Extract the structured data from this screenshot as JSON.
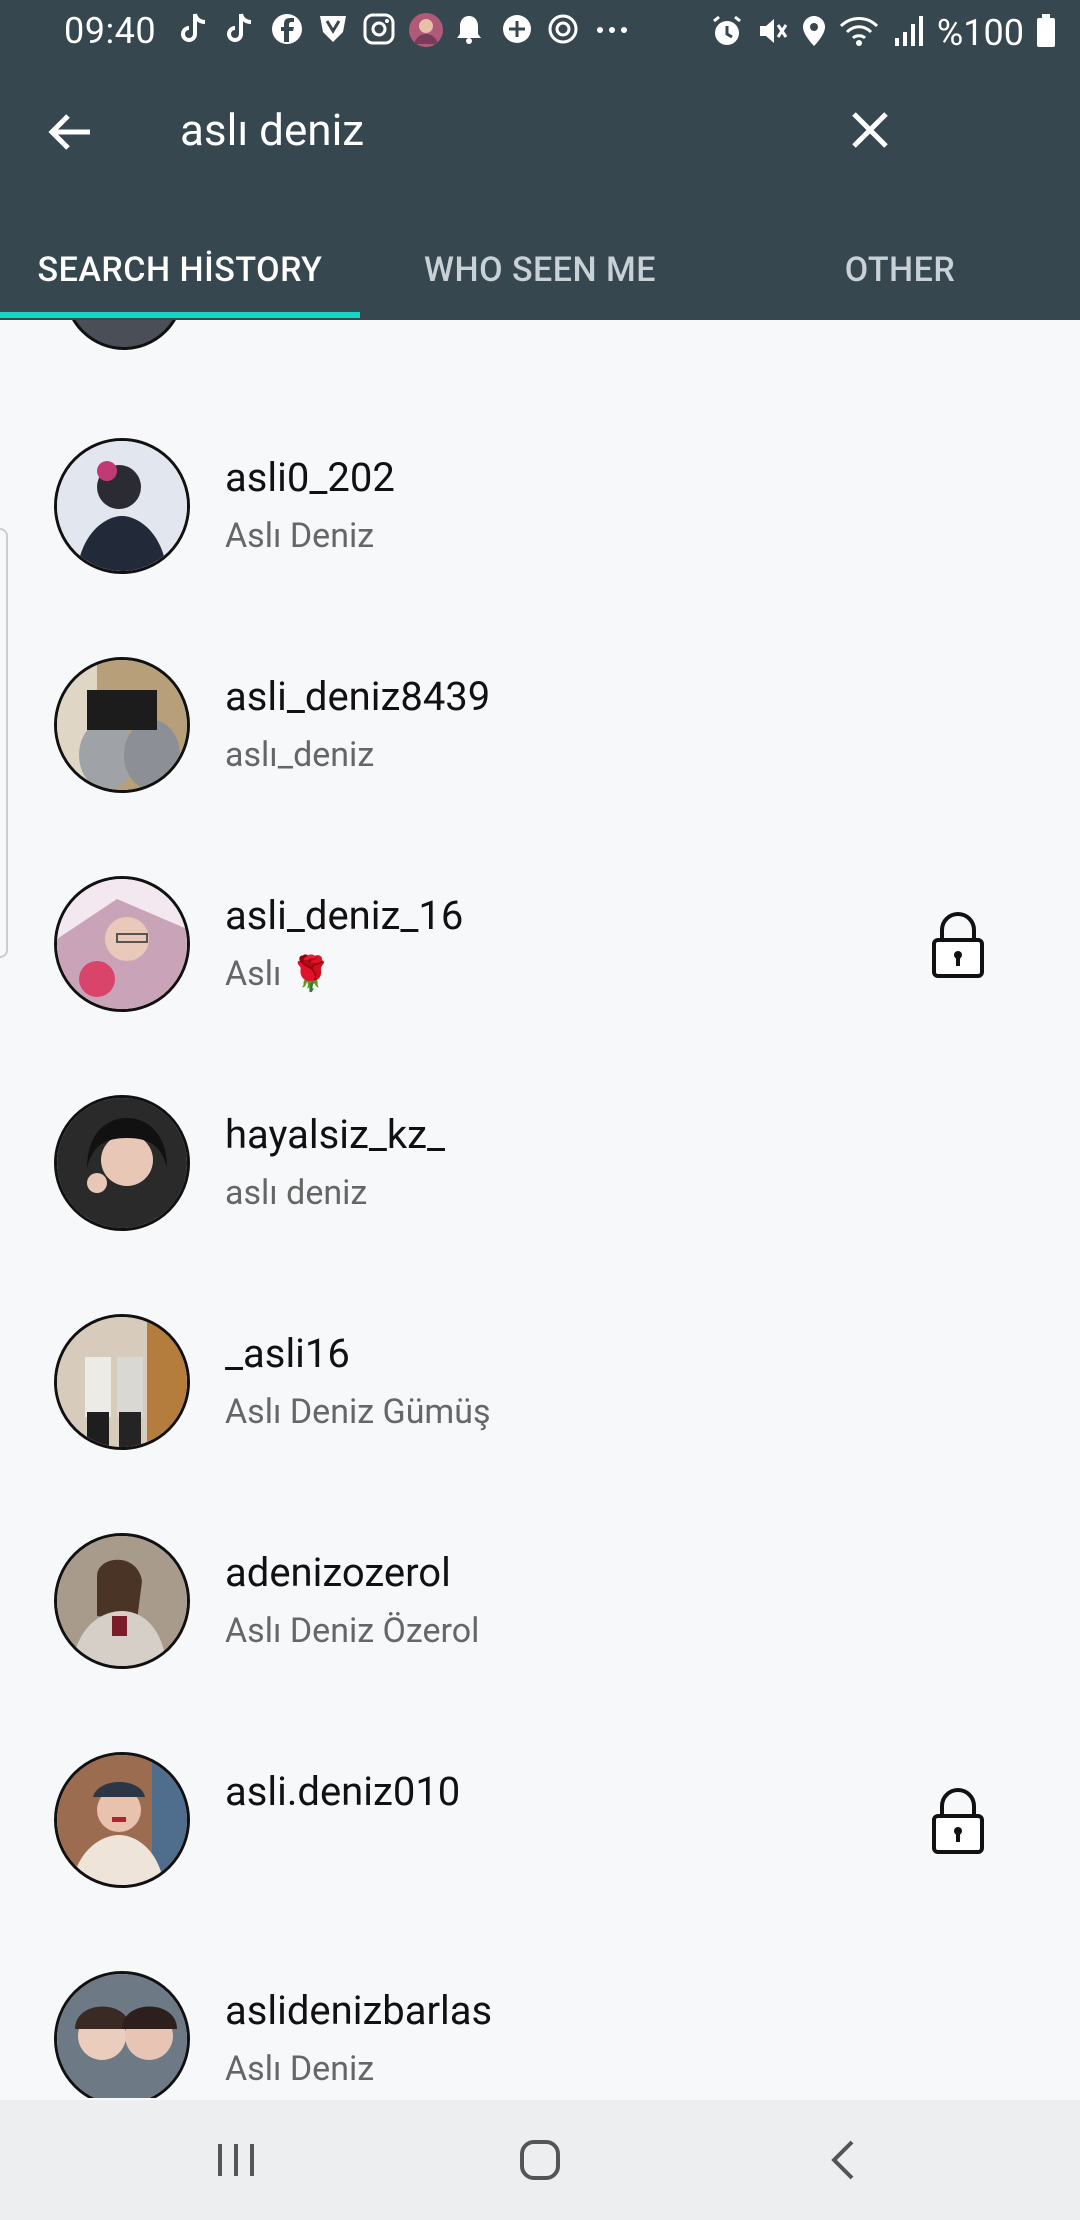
{
  "status_bar": {
    "time": "09:40",
    "battery": "%100",
    "icons": [
      "tiktok-icon",
      "tiktok-icon",
      "facebook-icon",
      "shield-icon",
      "instagram-icon",
      "avatar-icon",
      "bell-icon",
      "vpn-icon",
      "sync-icon",
      "more-icon",
      "alarm-icon",
      "mute-icon",
      "location-icon",
      "wifi-icon",
      "signal-icon",
      "battery-icon"
    ]
  },
  "appbar": {
    "search_query": "aslı deniz"
  },
  "tabs": [
    {
      "label": "SEARCH HİSTORY",
      "active": true
    },
    {
      "label": "WHO SEEN ME",
      "active": false
    },
    {
      "label": "OTHER",
      "active": false
    }
  ],
  "results": [
    {
      "username": "asli0_202",
      "fullname": "Aslı Deniz",
      "locked": false,
      "avatar_color": "#d6dbe4"
    },
    {
      "username": "asli_deniz8439",
      "fullname": "aslı_deniz",
      "locked": false,
      "avatar_color": "#8c7a66"
    },
    {
      "username": "asli_deniz_16",
      "fullname": "Aslı 🌹",
      "locked": true,
      "avatar_color": "#e7b9c8"
    },
    {
      "username": "hayalsiz_kz_",
      "fullname": "aslı deniz",
      "locked": false,
      "avatar_color": "#3b3b3b"
    },
    {
      "username": "_asli16",
      "fullname": "Aslı Deniz Gümüş",
      "locked": false,
      "avatar_color": "#a3865c"
    },
    {
      "username": "adenizozerol",
      "fullname": "Aslı Deniz Özerol",
      "locked": false,
      "avatar_color": "#b3a595"
    },
    {
      "username": "asli.deniz010",
      "fullname": "",
      "locked": true,
      "avatar_color": "#d2b7a2"
    },
    {
      "username": "aslidenizbarlas",
      "fullname": "Aslı Deniz",
      "locked": false,
      "avatar_color": "#6f7b87"
    }
  ],
  "colors": {
    "header_bg": "#37474f",
    "tab_indicator": "#19d3c5",
    "list_bg": "#f7f8fa"
  }
}
